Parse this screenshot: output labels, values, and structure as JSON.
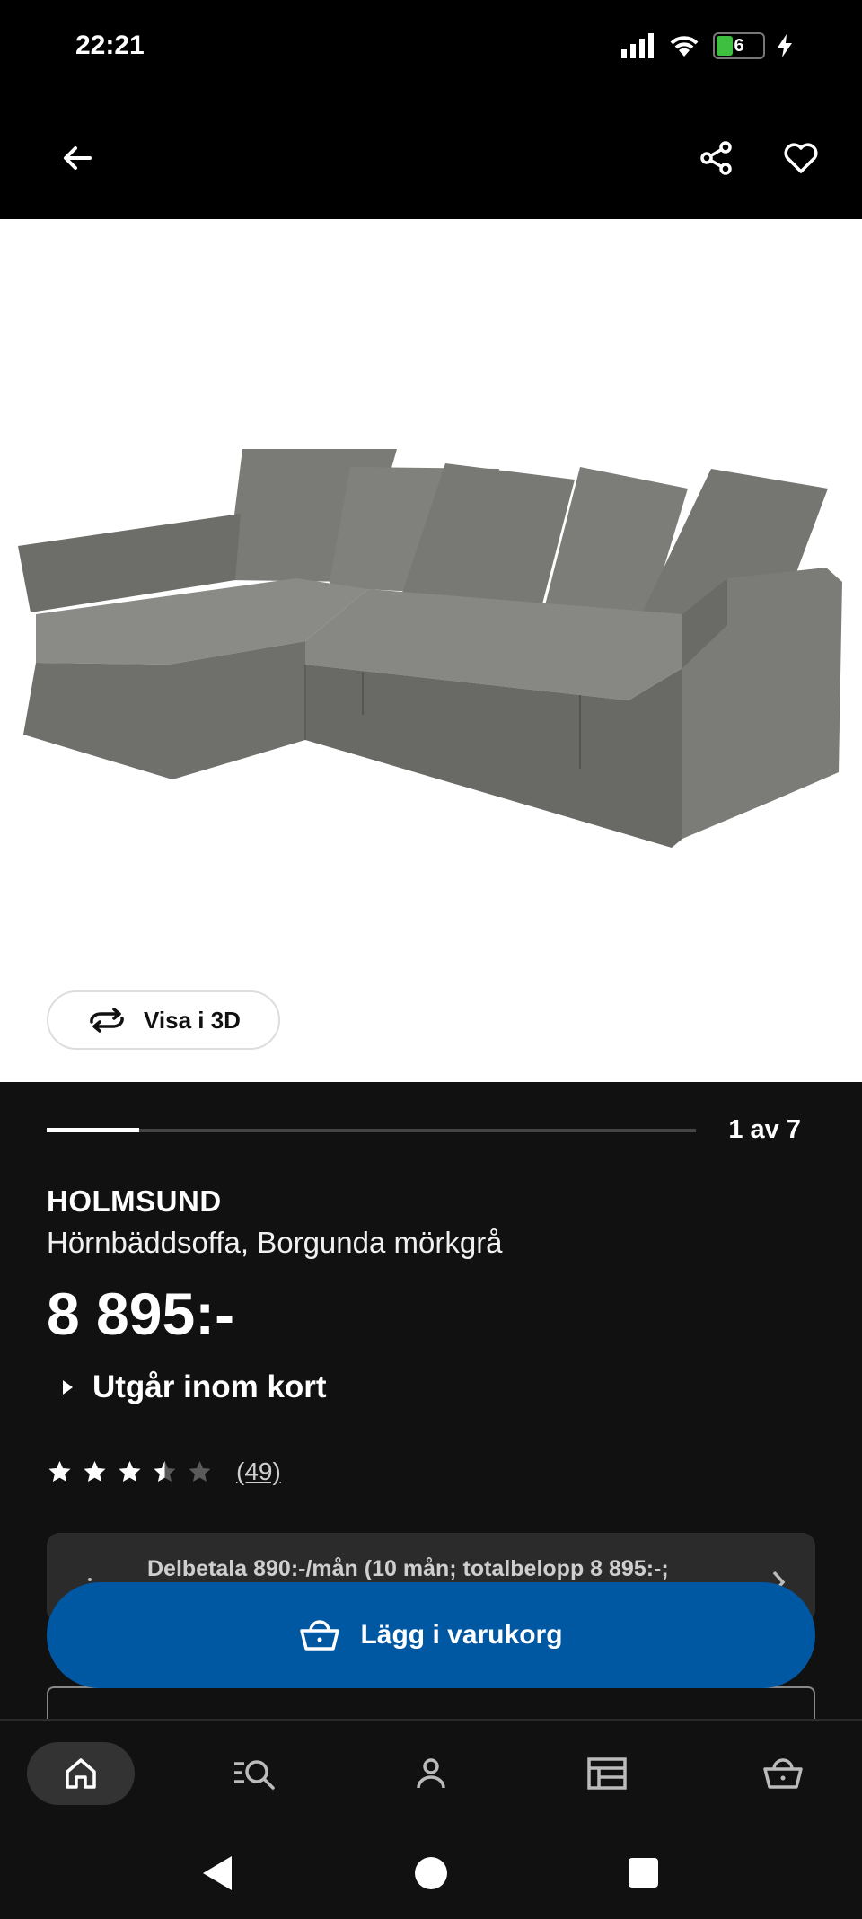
{
  "status_bar": {
    "time": "22:21",
    "battery_level": "6"
  },
  "header": {
    "back_icon": "arrow-left-icon",
    "share_icon": "share-icon",
    "favorite_icon": "heart-outline-icon"
  },
  "gallery": {
    "view_3d_label": "Visa i 3D",
    "counter": "1 av 7",
    "current": 1,
    "total": 7
  },
  "product": {
    "name": "HOLMSUND",
    "description": "Hörnbäddsoffa, Borgunda mörkgrå",
    "price": "8 895:-",
    "availability": "Utgår inom kort",
    "rating": 3.5,
    "rating_max": 5,
    "review_count": "(49)"
  },
  "installment": {
    "text": "Delbetala 890:-/mån (10 mån; totalbelopp 8 895:-;"
  },
  "cart": {
    "add_label": "Lägg i varukorg"
  },
  "bottom_nav": {
    "items": [
      {
        "icon": "home-icon",
        "active": true
      },
      {
        "icon": "search-list-icon"
      },
      {
        "icon": "profile-icon"
      },
      {
        "icon": "store-icon"
      },
      {
        "icon": "cart-icon"
      }
    ]
  },
  "colors": {
    "background": "#111111",
    "accent_blue": "#0058a3",
    "image_background": "#ffffff"
  }
}
